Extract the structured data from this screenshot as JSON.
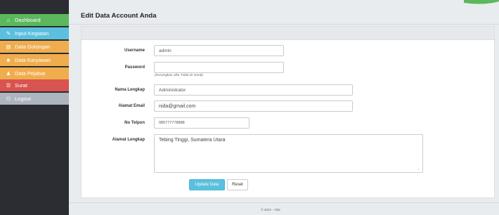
{
  "sidebar": {
    "items": [
      {
        "label": "Dashboard",
        "icon": "home-icon",
        "color": "#5cb85c"
      },
      {
        "label": "Input Kegiatan",
        "icon": "edit-icon",
        "color": "#5bc0de"
      },
      {
        "label": "Data Golongan",
        "icon": "folder-icon",
        "color": "#f0ad4e"
      },
      {
        "label": "Data Karyawan",
        "icon": "users-icon",
        "color": "#f0ad4e"
      },
      {
        "label": "Data Pejabat",
        "icon": "user-icon",
        "color": "#f0ad4e"
      },
      {
        "label": "Surat",
        "icon": "list-icon",
        "color": "#d9534f"
      },
      {
        "label": "Logout",
        "icon": "power-icon",
        "color": "#adb5bd"
      }
    ]
  },
  "page": {
    "title": "Edit Data Account Anda"
  },
  "form": {
    "username_label": "Username",
    "username_value": "admin",
    "password_label": "Password",
    "password_value": "",
    "password_hint": "(Kosongkan Jika Tidak Di Ganti)",
    "nama_label": "Nama Lengkap",
    "nama_value": "Administrator",
    "email_label": "Alamat Email",
    "email_value": "nida@gmail.com",
    "telpon_label": "No Telpon",
    "telpon_value": "085777778888",
    "alamat_label": "Alamat Lengkap",
    "alamat_value": "Tebing Tinggi, Sumatera Utara",
    "update_label": "Update Data",
    "reset_label": "Reset"
  },
  "footer": {
    "text": "© 2023 - Yida"
  },
  "colors": {
    "sidebar_bg": "#2b2d33",
    "accent": "#5cb85c",
    "primary_button": "#5bc0de"
  }
}
